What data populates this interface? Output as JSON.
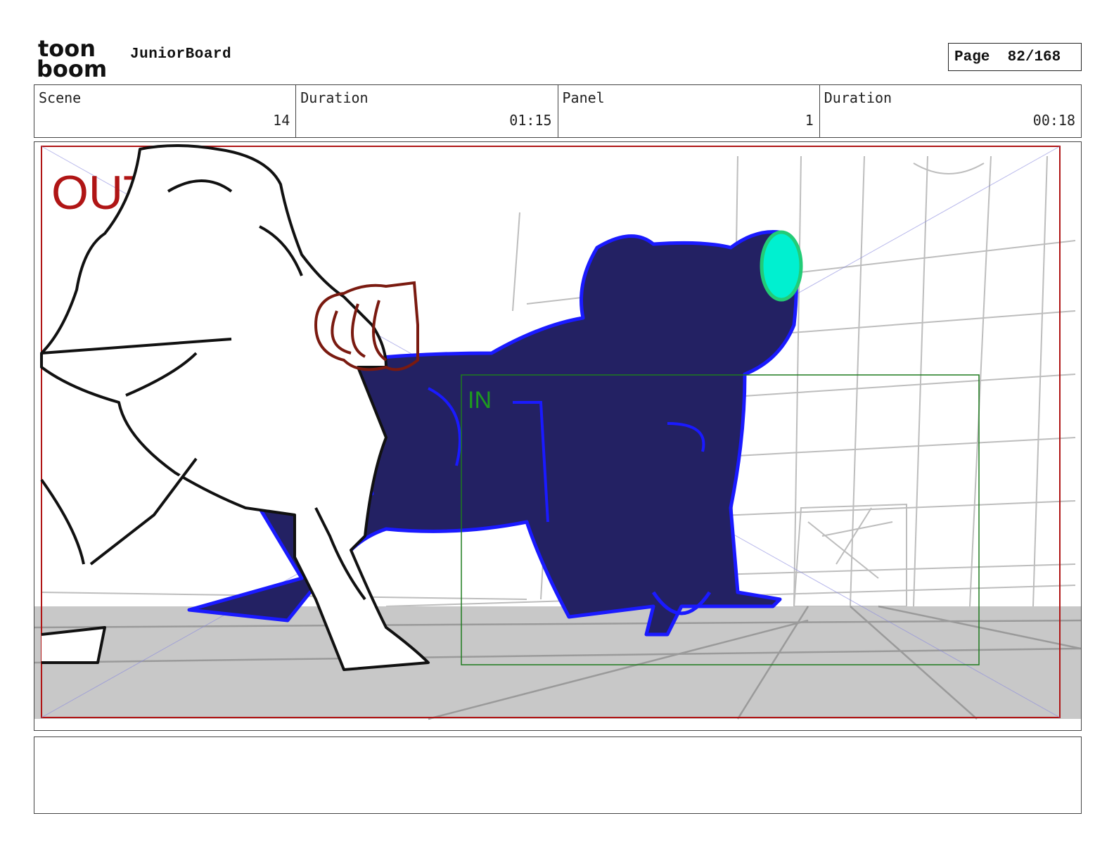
{
  "header": {
    "logo_text_top": "toon",
    "logo_text_bottom": "boom",
    "app_title": "JuniorBoard",
    "page_label": "Page",
    "page_value": "82/168"
  },
  "info": {
    "scene_label": "Scene",
    "scene_value": "14",
    "scene_duration_label": "Duration",
    "scene_duration_value": "01:15",
    "panel_label": "Panel",
    "panel_value": "1",
    "panel_duration_label": "Duration",
    "panel_duration_value": "00:18"
  },
  "panel": {
    "out_label": "OUT",
    "in_label": "IN"
  },
  "colors": {
    "out_frame": "#b01515",
    "in_frame": "#1e7b1e",
    "creature_fill": "#232163",
    "creature_outline": "#1a1aff",
    "eye": "#00f0d0",
    "eye_outline": "#22cc77",
    "fist": "#7a1a10",
    "floor": "#c8c8c8"
  },
  "notes": ""
}
